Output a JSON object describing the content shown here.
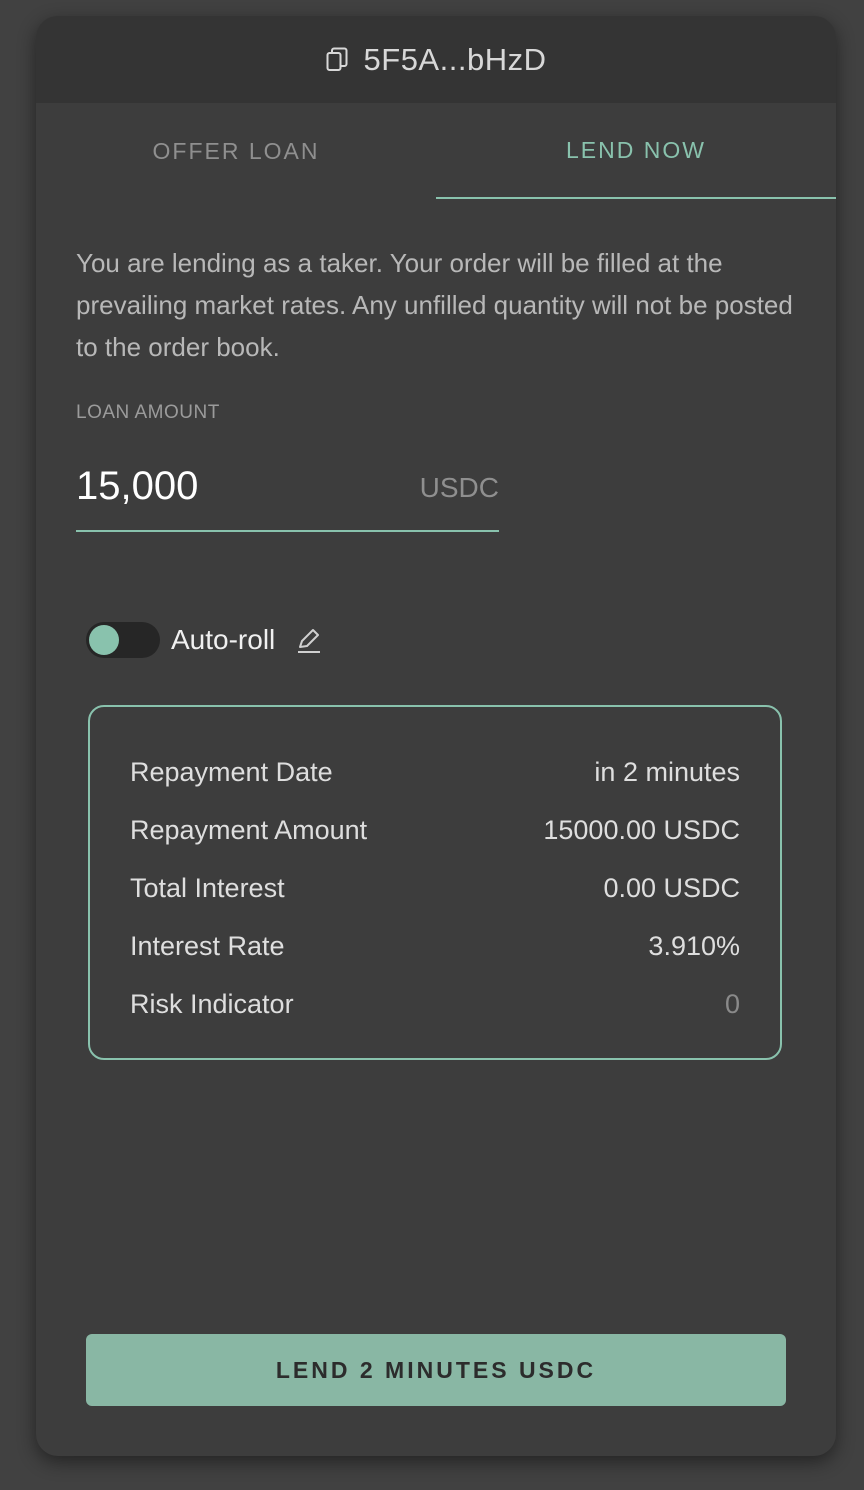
{
  "header": {
    "copy_icon": "copy-icon",
    "address": "5F5A...bHzD"
  },
  "tabs": [
    {
      "label": "OFFER LOAN",
      "active": false
    },
    {
      "label": "LEND NOW",
      "active": true
    }
  ],
  "description": "You are lending as a taker. Your order will be filled at the prevailing market rates. Any unfilled quantity will not be posted to the order book.",
  "loan_amount": {
    "label": "LOAN AMOUNT",
    "value": "15,000",
    "unit": "USDC"
  },
  "auto_roll": {
    "label": "Auto-roll",
    "enabled": false,
    "edit_icon": "pencil-icon"
  },
  "summary": {
    "rows": [
      {
        "label": "Repayment Date",
        "value": "in 2 minutes"
      },
      {
        "label": "Repayment Amount",
        "value": "15000.00 USDC"
      },
      {
        "label": "Total Interest",
        "value": "0.00 USDC"
      },
      {
        "label": "Interest Rate",
        "value": "3.910%"
      },
      {
        "label": "Risk Indicator",
        "value": "0"
      }
    ]
  },
  "action": {
    "label": "LEND 2 MINUTES USDC"
  },
  "colors": {
    "accent": "#89c2ad",
    "button": "#89b7a4",
    "panel": "#3d3d3d",
    "header": "#343434",
    "background": "#414141"
  }
}
